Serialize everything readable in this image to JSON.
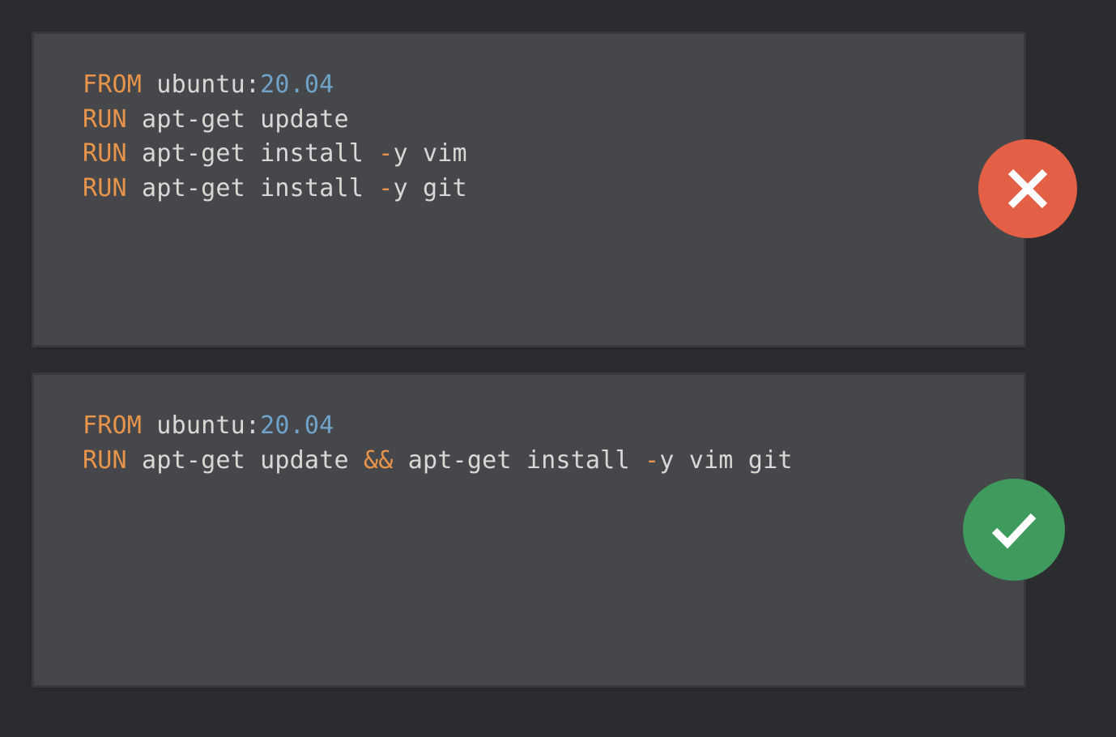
{
  "colors": {
    "background": "#2b2c2f",
    "panel": "#46474a",
    "keyword": "#e8944a",
    "number": "#6fa3c9",
    "text": "#d8d8d8",
    "bad": "#e35f45",
    "good": "#3f9a5d"
  },
  "examples": [
    {
      "status": "incorrect",
      "icon": "x-icon",
      "lines": [
        [
          {
            "type": "kw",
            "text": "FROM"
          },
          {
            "type": "txt",
            "text": " ubuntu:"
          },
          {
            "type": "num",
            "text": "20.04"
          }
        ],
        [
          {
            "type": "kw",
            "text": "RUN"
          },
          {
            "type": "txt",
            "text": " apt-get update"
          }
        ],
        [
          {
            "type": "kw",
            "text": "RUN"
          },
          {
            "type": "txt",
            "text": " apt-get install "
          },
          {
            "type": "op",
            "text": "-"
          },
          {
            "type": "txt",
            "text": "y vim"
          }
        ],
        [
          {
            "type": "kw",
            "text": "RUN"
          },
          {
            "type": "txt",
            "text": " apt-get install "
          },
          {
            "type": "op",
            "text": "-"
          },
          {
            "type": "txt",
            "text": "y git"
          }
        ]
      ]
    },
    {
      "status": "correct",
      "icon": "check-icon",
      "lines": [
        [
          {
            "type": "kw",
            "text": "FROM"
          },
          {
            "type": "txt",
            "text": " ubuntu:"
          },
          {
            "type": "num",
            "text": "20.04"
          }
        ],
        [
          {
            "type": "kw",
            "text": "RUN"
          },
          {
            "type": "txt",
            "text": " apt-get update "
          },
          {
            "type": "op",
            "text": "&&"
          },
          {
            "type": "txt",
            "text": " apt-get install "
          },
          {
            "type": "op",
            "text": "-"
          },
          {
            "type": "txt",
            "text": "y vim git"
          }
        ]
      ]
    }
  ]
}
